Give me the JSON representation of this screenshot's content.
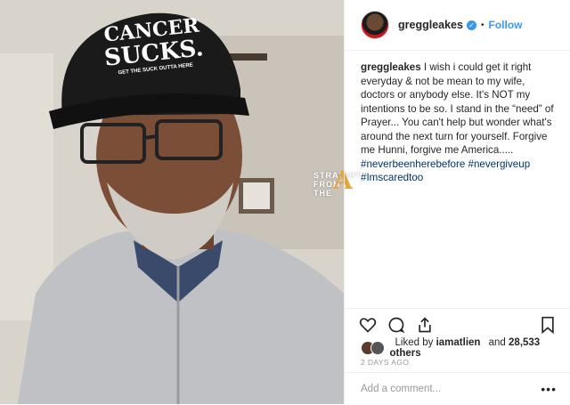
{
  "photo": {
    "hat_line1": "CANCER",
    "hat_line2": "SUCKS.",
    "hat_line3": "GET THE SUCK OUTTA HERE",
    "watermark_line1": "STRAIGHT",
    "watermark_line2": "FROM",
    "watermark_line3": "THE",
    "watermark_letter": "A"
  },
  "header": {
    "username": "greggleakes",
    "verified_mark": "✓",
    "dot": "•",
    "follow_label": "Follow"
  },
  "caption": {
    "username": "greggleakes",
    "text": "I wish i could get it right everyday & not be mean to my wife, doctors or anybody else. It's NOT my intentions to be so. I stand in the “need” of Prayer... You can't help but wonder what's around the next turn for yourself. Forgive me Hunni, forgive me America.....",
    "hashtags": [
      "#neverbeenherebefore #nevergiveup",
      "#Imscaredtoo"
    ]
  },
  "actions": {
    "icons": [
      "heart-icon",
      "comment-icon",
      "share-icon",
      "bookmark-icon"
    ]
  },
  "likes": {
    "prefix": "Liked by",
    "user": "iamatlien",
    "middle": "and",
    "count": "28,533 others"
  },
  "timestamp": "2 DAYS AGO",
  "comment_box": {
    "placeholder": "Add a comment...",
    "more": "•••"
  },
  "colors": {
    "link": "#3897f0",
    "hashtag": "#003569",
    "muted": "#999999"
  }
}
